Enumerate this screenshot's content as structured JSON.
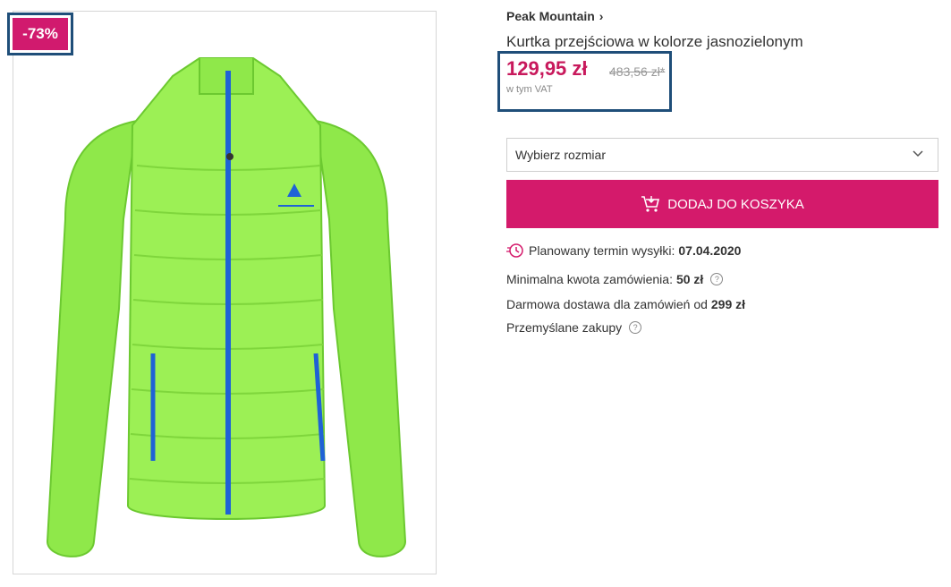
{
  "badge": {
    "discount": "-73%"
  },
  "product": {
    "brand": "Peak Mountain",
    "title": "Kurtka przejściowa w kolorze jasnozielonym",
    "price_current": "129,95 zł",
    "price_old": "483,56 zł*",
    "vat_note": "w tym VAT"
  },
  "size_select": {
    "placeholder": "Wybierz rozmiar"
  },
  "cart_button": {
    "label": "DODAJ DO KOSZYKA"
  },
  "shipping": {
    "label": "Planowany termin wysyłki:",
    "date": "07.04.2020"
  },
  "min_order": {
    "label": "Minimalna kwota zamówienia:",
    "value": "50 zł"
  },
  "free_delivery": {
    "label": "Darmowa dostawa dla zamówień od",
    "value": "299 zł"
  },
  "smart_shopping": {
    "label": "Przemyślane zakupy"
  },
  "colors": {
    "accent": "#d41a6b",
    "price": "#c8195c",
    "highlight_border": "#1f4e79"
  }
}
